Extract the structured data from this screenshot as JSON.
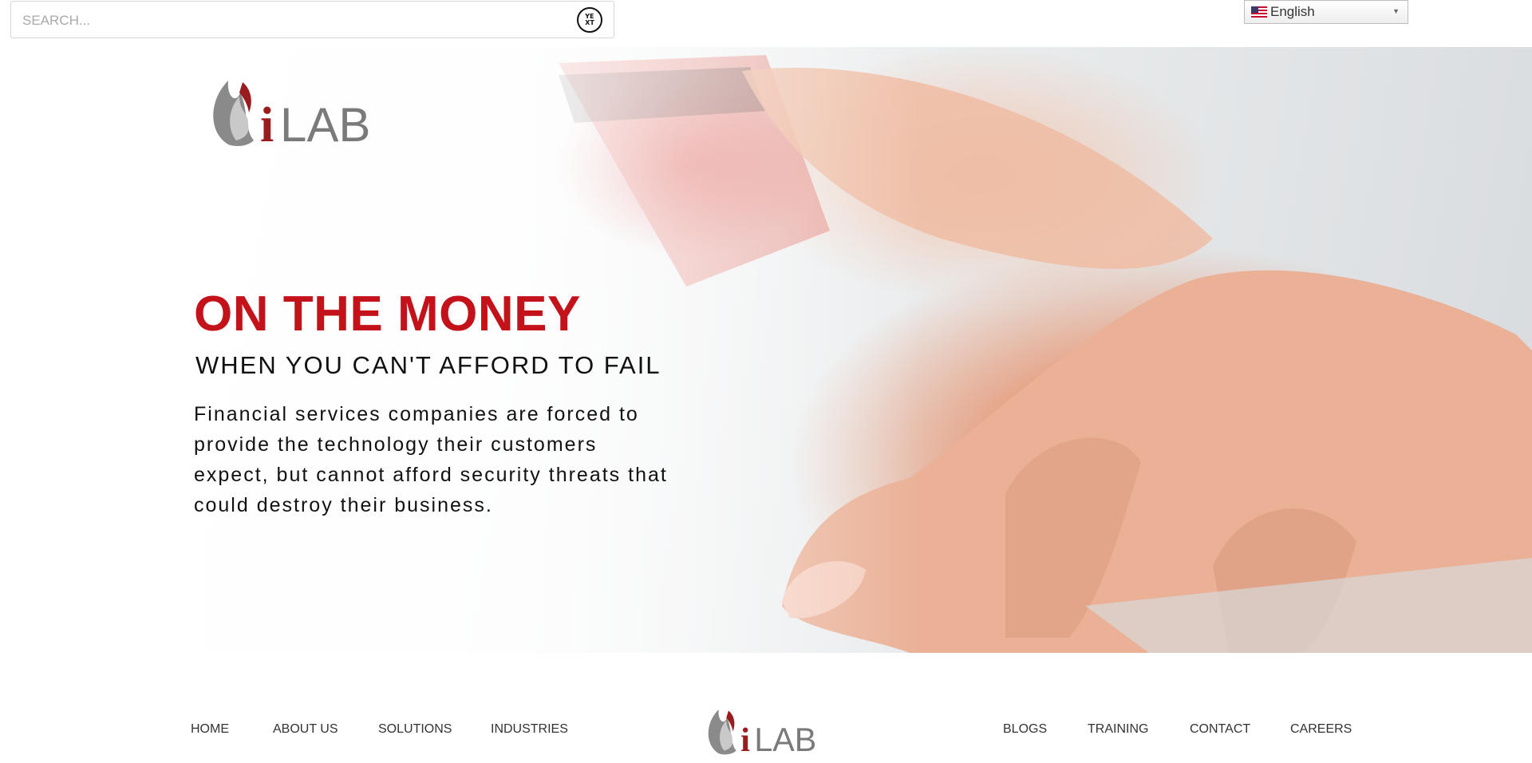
{
  "search": {
    "placeholder": "SEARCH...",
    "icon": "yext-icon"
  },
  "language": {
    "selected": "English",
    "flag": "us-flag-icon"
  },
  "brand": {
    "logo_text": "iLAB",
    "logo_accent_color": "#9b1c1f",
    "logo_gray": "#7a7a7a"
  },
  "hero": {
    "title": "ON THE MONEY",
    "subtitle": "WHEN YOU CAN'T AFFORD TO FAIL",
    "body": "Financial services companies are forced to provide the technology their customers expect, but cannot afford security threats that could destroy their business.",
    "title_color": "#c4121a"
  },
  "nav": {
    "left": [
      "HOME",
      "ABOUT US",
      "SOLUTIONS",
      "INDUSTRIES"
    ],
    "right": [
      "BLOGS",
      "TRAINING",
      "CONTACT",
      "CAREERS"
    ]
  }
}
